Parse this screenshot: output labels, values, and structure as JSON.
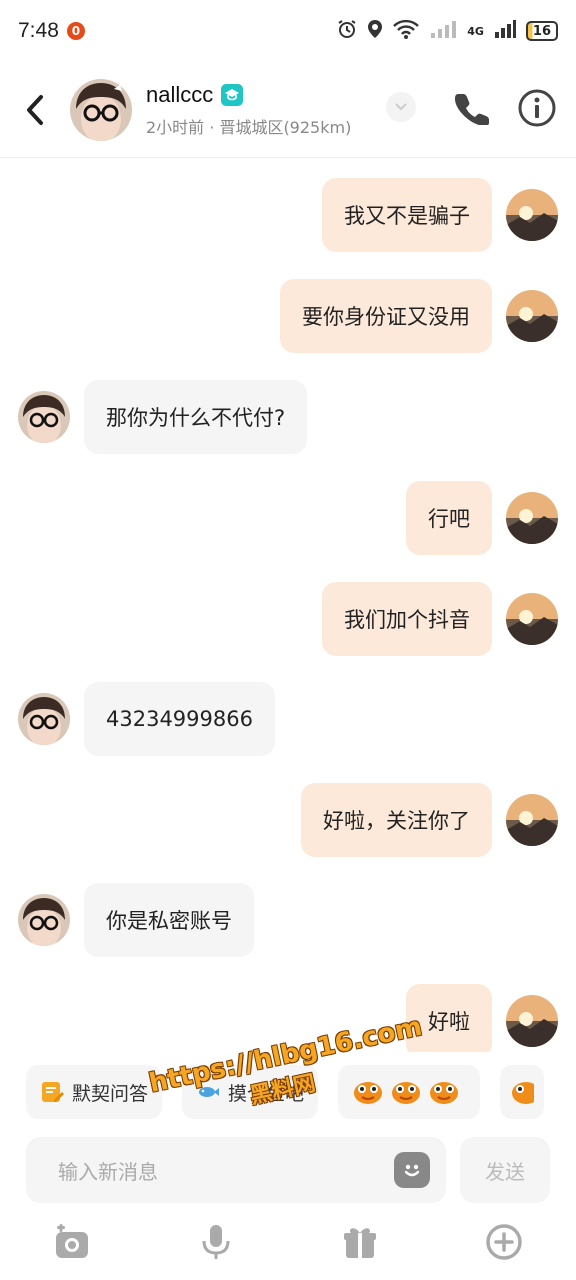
{
  "status_bar": {
    "time": "7:48",
    "notification_count": "0",
    "signal_a": "6",
    "network": "4G",
    "battery": "16"
  },
  "header": {
    "name": "nallccc",
    "subtitle": "2小时前 · 晋城城区(925km)"
  },
  "messages": [
    {
      "side": "right",
      "text": "我又不是骗子"
    },
    {
      "side": "right",
      "text": "要你身份证又没用"
    },
    {
      "side": "left",
      "text": "那你为什么不代付?"
    },
    {
      "side": "right",
      "text": "行吧"
    },
    {
      "side": "right",
      "text": "我们加个抖音"
    },
    {
      "side": "left",
      "text": "43234999866"
    },
    {
      "side": "right",
      "text": "好啦，关注你了"
    },
    {
      "side": "left",
      "text": "你是私密账号"
    },
    {
      "side": "right",
      "text": "好啦"
    }
  ],
  "chips": [
    {
      "label": "默契问答"
    },
    {
      "label": "摸个鱼吧"
    },
    {
      "label": ""
    }
  ],
  "watermark": {
    "line1": "https://hlbg16.com",
    "line2": "黑料网"
  },
  "composer": {
    "placeholder": "输入新消息",
    "send_label": "发送"
  },
  "colors": {
    "outgoing_bubble": "#fde9da",
    "incoming_bubble": "#f5f5f5",
    "verify_badge": "#20c6c6"
  }
}
